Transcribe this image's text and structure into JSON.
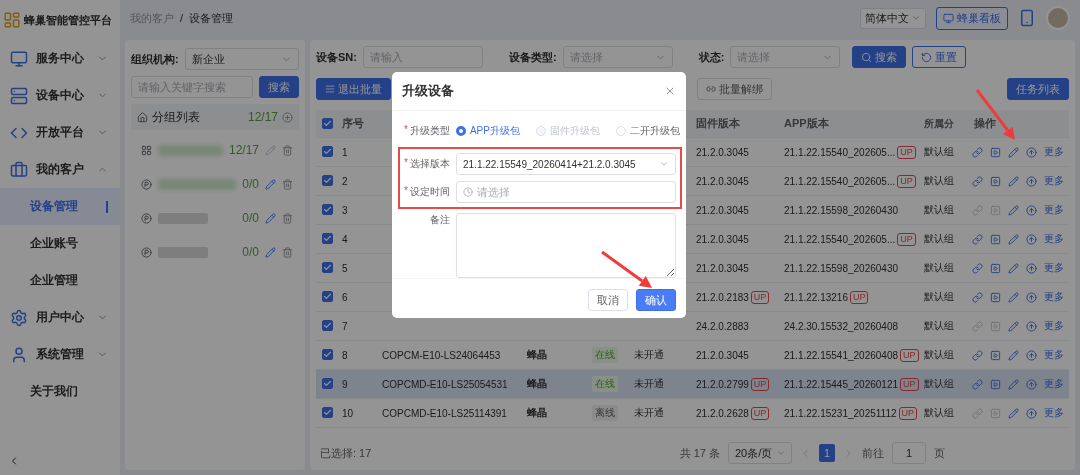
{
  "brand": {
    "name": "蜂巢智能管控平台"
  },
  "sidebar": {
    "items": [
      {
        "label": "服务中心",
        "kind": "group",
        "expanded": false
      },
      {
        "label": "设备中心",
        "kind": "group",
        "expanded": false
      },
      {
        "label": "开放平台",
        "kind": "group",
        "expanded": false
      },
      {
        "label": "我的客户",
        "kind": "group",
        "expanded": true,
        "children": [
          {
            "label": "设备管理",
            "selected": true
          },
          {
            "label": "企业账号",
            "selected": false
          },
          {
            "label": "企业管理",
            "selected": false
          }
        ]
      },
      {
        "label": "用户中心",
        "kind": "group",
        "expanded": false
      },
      {
        "label": "系统管理",
        "kind": "group",
        "expanded": false
      },
      {
        "label": "关于我们",
        "kind": "link"
      }
    ]
  },
  "header": {
    "breadcrumb": [
      {
        "label": "我的客户"
      },
      {
        "label": "设备管理"
      }
    ],
    "separator": "/",
    "language": "简体中文",
    "dashboard_button": "蜂巢看板"
  },
  "group_panel": {
    "org_label": "组织机构:",
    "org_value": "新企业",
    "search_placeholder": "请输入关键字搜索",
    "search_button": "搜索",
    "list_title": "分组列表",
    "list_count": "12/17",
    "groups": [
      {
        "kind": "folder",
        "count": "12/17",
        "editable": false
      },
      {
        "kind": "project",
        "count": "0/0",
        "editable": true
      },
      {
        "kind": "project",
        "count": "0/0",
        "editable": true
      },
      {
        "kind": "project",
        "count": "0/0",
        "editable": true
      }
    ]
  },
  "filters": [
    {
      "label": "设备SN:",
      "placeholder": "请输入",
      "kind": "input"
    },
    {
      "label": "设备类型:",
      "placeholder": "请选择",
      "kind": "select"
    },
    {
      "label": "状态:",
      "placeholder": "请选择",
      "kind": "select"
    }
  ],
  "search_button": "搜索",
  "reset_button": "重置",
  "toolbar": {
    "exit_batch": "退出批量",
    "unbind": "批量解绑",
    "task_list": "任务列表"
  },
  "table": {
    "select_all": true,
    "header": {
      "index": "序号",
      "firmware": "固件版本",
      "app": "APP版本",
      "column_8": "所属分",
      "actions": "操作"
    },
    "rows": [
      {
        "checked": true,
        "highlighted": false,
        "index": "1",
        "firmware": "21.2.0.3045",
        "app": "21.1.22.15540_202605...",
        "app_badge": "UP",
        "group": "默认组",
        "links_enabled": true,
        "more": "更多"
      },
      {
        "checked": true,
        "highlighted": false,
        "index": "2",
        "firmware": "21.2.0.3045",
        "app": "21.1.22.15540_202605...",
        "app_badge": "UP",
        "group": "默认组",
        "links_enabled": true,
        "more": "更多"
      },
      {
        "checked": true,
        "highlighted": false,
        "index": "3",
        "firmware": "21.2.0.3045",
        "app": "21.1.22.15598_20260430",
        "group": "默认组",
        "links_enabled": false,
        "more": "更多"
      },
      {
        "checked": true,
        "highlighted": false,
        "index": "4",
        "firmware": "21.2.0.3045",
        "app": "21.1.22.15540_202605...",
        "app_badge": "UP",
        "group": "默认组",
        "links_enabled": true,
        "more": "更多"
      },
      {
        "checked": true,
        "highlighted": false,
        "index": "5",
        "firmware": "21.2.0.3045",
        "app": "21.1.22.15598_20260430",
        "group": "默认组",
        "links_enabled": true,
        "more": "更多"
      },
      {
        "checked": true,
        "highlighted": false,
        "index": "6",
        "firmware": "21.2.0.2183",
        "firmware_badge": "UP",
        "app": "21.1.22.13216",
        "app_badge": "UP",
        "group": "默认组",
        "links_enabled": true,
        "more": "更多"
      },
      {
        "checked": true,
        "highlighted": false,
        "index": "7",
        "firmware": "24.2.0.2883",
        "app": "24.2.30.15532_20260408",
        "group": "默认组",
        "links_enabled": false,
        "more": "更多"
      },
      {
        "checked": true,
        "highlighted": false,
        "index": "8",
        "sn": "COPCM-E10-LS24064453",
        "type": "蜂晶",
        "status": {
          "label": "在线",
          "kind": "online"
        },
        "open": "未开通",
        "firmware": "21.2.0.3045",
        "app": "21.1.22.15541_20260408",
        "app_badge": "UP",
        "group": "默认组",
        "links_enabled": true,
        "more": "更多"
      },
      {
        "checked": true,
        "highlighted": true,
        "index": "9",
        "sn": "COPCMD-E10-LS25054531",
        "type": "蜂晶",
        "status": {
          "label": "在线",
          "kind": "online"
        },
        "open": "未开通",
        "firmware": "21.2.0.2799",
        "firmware_badge": "UP",
        "app": "21.1.22.15445_20260121",
        "app_badge": "UP",
        "group": "默认组",
        "links_enabled": true,
        "more": "更多"
      },
      {
        "checked": true,
        "highlighted": false,
        "index": "10",
        "sn": "COPCMD-E10-LS25114391",
        "type": "蜂晶",
        "status": {
          "label": "离线",
          "kind": "offline"
        },
        "open": "未开通",
        "firmware": "21.2.0.2628",
        "firmware_badge": "UP",
        "app": "21.1.22.15231_20251112",
        "app_badge": "UP",
        "group": "默认组",
        "links_enabled": false,
        "more": "更多"
      }
    ]
  },
  "footer": {
    "selected": "已选择: 17",
    "total": "共 17 条",
    "page_size": "20条/页",
    "pages": [
      {
        "label": "1",
        "selected": true
      }
    ],
    "goto_label": "前往",
    "goto_value": "1",
    "page_suffix": "页"
  },
  "modal": {
    "title": "升级设备",
    "mark": "*",
    "type_label": "升级类型",
    "type_options": [
      {
        "label": "APP升级包",
        "selected": true,
        "disabled": false
      },
      {
        "label": "固件升级包",
        "selected": false,
        "disabled": true
      },
      {
        "label": "二开升级包",
        "selected": false,
        "disabled": false
      }
    ],
    "version_label": "选择版本",
    "version_value": "21.1.22.15549_20260414+21.2.0.3045",
    "time_label": "设定时间",
    "time_placeholder": "请选择",
    "remark_label": "备注",
    "cancel": "取消",
    "confirm": "确认"
  }
}
